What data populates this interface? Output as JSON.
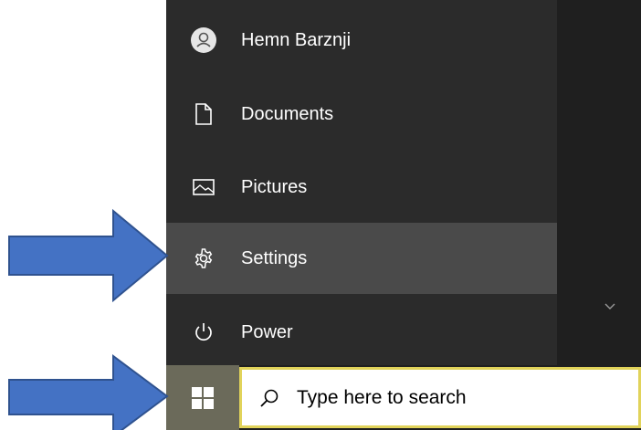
{
  "start_menu": {
    "items": [
      {
        "label": "Hemn Barznji",
        "icon": "user-avatar-icon"
      },
      {
        "label": "Documents",
        "icon": "document-icon"
      },
      {
        "label": "Pictures",
        "icon": "picture-icon"
      },
      {
        "label": "Settings",
        "icon": "gear-icon"
      },
      {
        "label": "Power",
        "icon": "power-icon"
      }
    ],
    "selected_item": "Settings"
  },
  "taskbar": {
    "start_button_icon": "windows-logo-icon",
    "search": {
      "placeholder": "Type here to search",
      "icon": "search-icon"
    }
  },
  "annotations": {
    "arrow_color": "#4472c4",
    "arrow_border": "#2f528f",
    "arrows": [
      "pointing-at-settings",
      "pointing-at-start-button"
    ]
  },
  "colors": {
    "menu_bg": "#2b2b2b",
    "selected_bg": "#4a4a4a",
    "search_border": "#e1d35a",
    "start_button_bg": "#6b6a5a"
  }
}
